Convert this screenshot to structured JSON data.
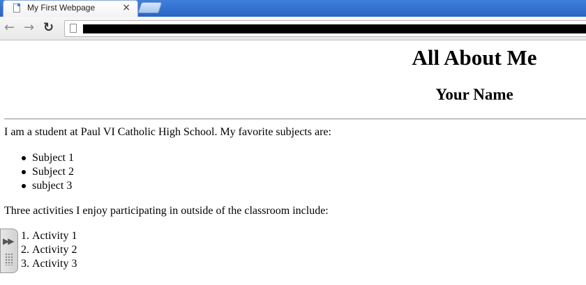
{
  "browser": {
    "tab": {
      "title": "My First Webpage",
      "close_glyph": "×"
    },
    "toolbar": {
      "back_glyph": "←",
      "forward_glyph": "→",
      "reload_glyph": "↻",
      "page_icon": "page-icon"
    }
  },
  "page": {
    "heading1": "All About Me",
    "heading2": "Your Name",
    "paragraph1": "I am a student at Paul VI Catholic High School. My favorite subjects are:",
    "subjects": [
      "Subject 1",
      "Subject 2",
      "subject 3"
    ],
    "paragraph2": "Three activities I enjoy participating in outside of the classroom include:",
    "activities": [
      {
        "number": "1.",
        "text": "Activity 1"
      },
      {
        "number": "2.",
        "text": "Activity 2"
      },
      {
        "number": "3.",
        "text": "Activity 3"
      }
    ]
  },
  "overlay": {
    "arrows_glyph": "▶▶",
    "icon": "drag-handle-icon"
  },
  "colors": {
    "titlebar": "#3f7fdb",
    "text": "#000000",
    "background": "#ffffff"
  }
}
